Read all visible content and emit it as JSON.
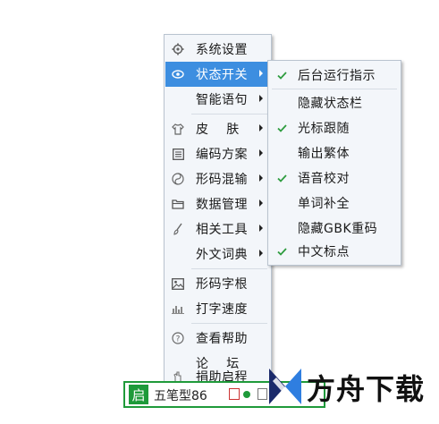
{
  "main_menu": {
    "items": [
      {
        "label": "系统设置",
        "icon": "gear-icon",
        "submenu": false
      },
      {
        "label": "状态开关",
        "icon": "eye-icon",
        "submenu": true,
        "highlighted": true
      },
      {
        "label": "智能语句",
        "icon": "",
        "submenu": true
      },
      {
        "label": "皮    肤",
        "icon": "shirt-icon",
        "submenu": true
      },
      {
        "label": "编码方案",
        "icon": "grid-icon",
        "submenu": true
      },
      {
        "label": "形码混输",
        "icon": "yin-yang-icon",
        "submenu": true
      },
      {
        "label": "数据管理",
        "icon": "folder-icon",
        "submenu": true
      },
      {
        "label": "相关工具",
        "icon": "brush-icon",
        "submenu": true
      },
      {
        "label": "外文词典",
        "icon": "",
        "submenu": true
      },
      {
        "label": "形码字根",
        "icon": "image-icon",
        "submenu": false
      },
      {
        "label": "打字速度",
        "icon": "bar-chart-icon",
        "submenu": false
      },
      {
        "label": "查看帮助",
        "icon": "help-icon",
        "submenu": false
      },
      {
        "label": "论    坛",
        "icon": "",
        "submenu": false
      },
      {
        "label": "捐助启程",
        "icon": "hand-icon",
        "submenu": false
      }
    ]
  },
  "sub_menu": {
    "items": [
      {
        "label": "后台运行指示",
        "checked": true
      },
      {
        "label": "隐藏状态栏",
        "checked": false
      },
      {
        "label": "光标跟随",
        "checked": true
      },
      {
        "label": "输出繁体",
        "checked": false
      },
      {
        "label": "语音校对",
        "checked": true
      },
      {
        "label": "单词补全",
        "checked": false
      },
      {
        "label": "隐藏GBK重码",
        "checked": false
      },
      {
        "label": "中文标点",
        "checked": true
      }
    ]
  },
  "ime_bar": {
    "logo": "启",
    "name": "五笔型86"
  },
  "watermark": {
    "text": "方舟下载"
  },
  "colors": {
    "highlight": "#3d8ee0",
    "check": "#2e9c3f",
    "ime_green": "#1e9a3a"
  }
}
